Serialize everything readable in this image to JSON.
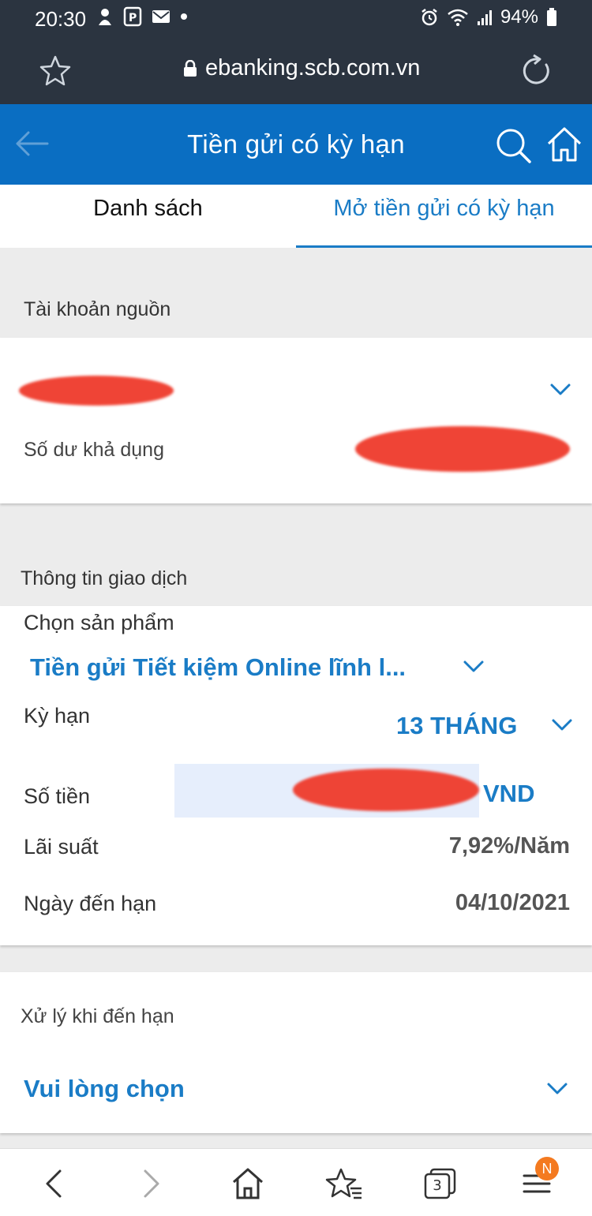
{
  "status_bar": {
    "time": "20:30",
    "battery": "94%",
    "icons": [
      "notification-icon",
      "parking-icon",
      "mail-icon",
      "dot-icon",
      "alarm-icon",
      "wifi-icon",
      "signal-icon",
      "battery-icon"
    ]
  },
  "browser": {
    "url": "ebanking.scb.com.vn",
    "icons": [
      "star-icon",
      "lock-icon",
      "reload-icon"
    ]
  },
  "header": {
    "title": "Tiền gửi có kỳ hạn"
  },
  "tabs": [
    {
      "label": "Danh sách",
      "active": false
    },
    {
      "label": "Mở tiền gửi có kỳ hạn",
      "active": true
    }
  ],
  "source_account": {
    "section_label": "Tài khoản nguồn",
    "available_balance_label": "Số dư khả dụng"
  },
  "transaction": {
    "section_label": "Thông tin giao dịch",
    "product_label": "Chọn sản phẩm",
    "product_value": "Tiền gửi Tiết kiệm Online lĩnh l...",
    "term_label": "Kỳ hạn",
    "term_value": "13 THÁNG",
    "amount_label": "Số tiền",
    "currency": "VND",
    "rate_label": "Lãi suất",
    "rate_value": "7,92%/Năm",
    "maturity_label": "Ngày đến hạn",
    "maturity_value": "04/10/2021"
  },
  "maturity_handling": {
    "label": "Xử lý khi đến hạn",
    "placeholder": "Vui lòng chọn"
  },
  "bottom_nav": {
    "tab_count": "3",
    "badge": "N"
  },
  "colors": {
    "header_blue": "#0a6ec2",
    "accent_blue": "#1a7cc6",
    "status_bar": "#2b3440",
    "redaction": "#ef3b2c"
  }
}
